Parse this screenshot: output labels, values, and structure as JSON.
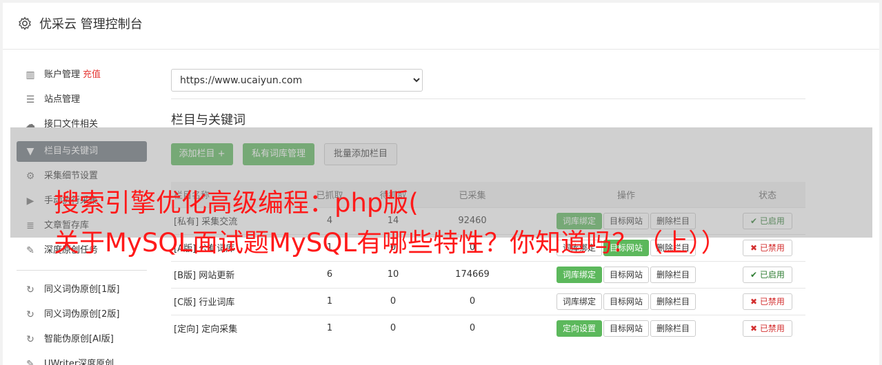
{
  "header": {
    "title": "优采云 管理控制台",
    "icon": "gear-icon"
  },
  "sidebar": {
    "items": [
      {
        "label": "账户管理",
        "badge": "充值",
        "icon": "bar-chart-icon"
      },
      {
        "label": "站点管理",
        "icon": "server-icon"
      },
      {
        "label": "接口文件相关",
        "icon": "cloud-upload-icon"
      },
      {
        "label": "栏目与关键词",
        "icon": "filter-icon",
        "active": true
      },
      {
        "label": "采集细节设置",
        "icon": "cogs-icon"
      },
      {
        "label": "手动执行采集",
        "icon": "play-icon"
      },
      {
        "label": "文章暂存库",
        "icon": "database-icon"
      },
      {
        "label": "深度原创任务",
        "icon": "edit-icon"
      },
      {
        "label": "同义词伪原创[1版]",
        "icon": "refresh-icon"
      },
      {
        "label": "同义词伪原创[2版]",
        "icon": "refresh-icon"
      },
      {
        "label": "智能伪原创[AI版]",
        "icon": "refresh-icon"
      },
      {
        "label": "UWriter深度原创",
        "icon": "edit-icon"
      }
    ]
  },
  "site_select": {
    "value": "https://www.ucaiyun.com"
  },
  "section": {
    "title": "栏目与关键词",
    "add_column_label": "添加栏目 +",
    "private_lib_label": "私有词库管理",
    "batch_add_label": "批量添加栏目"
  },
  "table": {
    "headers": [
      "栏目名称",
      "已抓取",
      "待抓取",
      "已采集",
      "操作",
      "状态"
    ],
    "rows": [
      {
        "tag": "[私有]",
        "name": "采集交流",
        "fetched": "4",
        "pending": "14",
        "collected": "92460",
        "op1": "词库绑定",
        "op2": "目标网站",
        "op3": "删除栏目",
        "status": "已启用"
      },
      {
        "tag": "[A版]",
        "name": "公有词库",
        "fetched": "1",
        "pending": "0",
        "collected": "0",
        "op1": "词库绑定",
        "op2": "目标网站",
        "op3": "删除栏目",
        "status": "已禁用"
      },
      {
        "tag": "[B版]",
        "name": "网站更新",
        "fetched": "6",
        "pending": "10",
        "collected": "174669",
        "op1": "词库绑定",
        "op2": "目标网站",
        "op3": "删除栏目",
        "status": "已启用"
      },
      {
        "tag": "[C版]",
        "name": "行业词库",
        "fetched": "1",
        "pending": "0",
        "collected": "0",
        "op1": "词库绑定",
        "op2": "目标网站",
        "op3": "删除栏目",
        "status": "已禁用"
      },
      {
        "tag": "[定向]",
        "name": "定向采集",
        "fetched": "1",
        "pending": "0",
        "collected": "0",
        "op1": "定向设置",
        "op2": "目标网站",
        "op3": "删除栏目",
        "status": "已禁用"
      }
    ]
  },
  "overlay": {
    "line1": "搜索引擎优化高级编程：php版(",
    "line2": "关于MySQL面试题MySQL有哪些特性？你知道吗？（上））"
  },
  "colors": {
    "accent_green": "#5cb85c",
    "active_nav": "#6c757d",
    "headline_red": "#ff1a1a"
  }
}
